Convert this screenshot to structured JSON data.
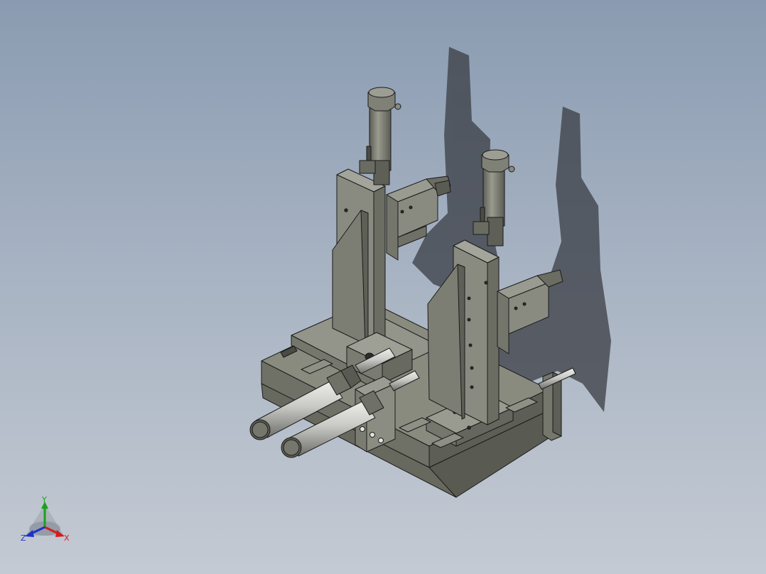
{
  "view": {
    "background_top": "#8a9bb1",
    "background_bottom": "#c4cad3",
    "part_color": "#85867a",
    "shadow_color": "#3a3d44",
    "rod_color": "#c9cac6"
  },
  "triad": {
    "y_label": "Y",
    "x_label": "X",
    "z_label": "Z",
    "y_color": "#1aa11a",
    "x_color": "#d21e1e",
    "z_color": "#1e32c8"
  }
}
